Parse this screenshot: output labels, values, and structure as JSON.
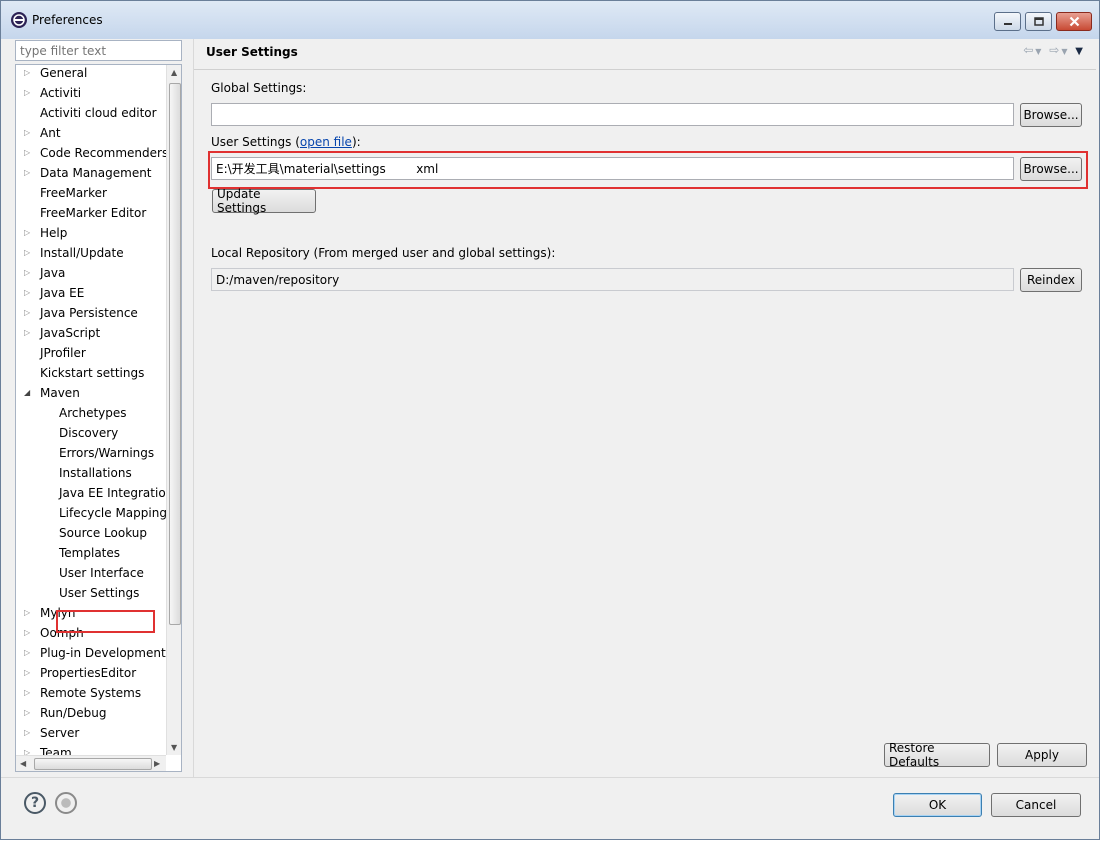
{
  "window": {
    "title": "Preferences"
  },
  "filter": {
    "placeholder": "type filter text"
  },
  "tree": {
    "items": [
      {
        "label": "General",
        "level": 0,
        "expandable": true
      },
      {
        "label": "Activiti",
        "level": 0,
        "expandable": true
      },
      {
        "label": "Activiti cloud editor",
        "level": 0,
        "expandable": false
      },
      {
        "label": "Ant",
        "level": 0,
        "expandable": true
      },
      {
        "label": "Code Recommenders",
        "level": 0,
        "expandable": true
      },
      {
        "label": "Data Management",
        "level": 0,
        "expandable": true
      },
      {
        "label": "FreeMarker",
        "level": 0,
        "expandable": false
      },
      {
        "label": "FreeMarker Editor",
        "level": 0,
        "expandable": false
      },
      {
        "label": "Help",
        "level": 0,
        "expandable": true
      },
      {
        "label": "Install/Update",
        "level": 0,
        "expandable": true
      },
      {
        "label": "Java",
        "level": 0,
        "expandable": true
      },
      {
        "label": "Java EE",
        "level": 0,
        "expandable": true
      },
      {
        "label": "Java Persistence",
        "level": 0,
        "expandable": true
      },
      {
        "label": "JavaScript",
        "level": 0,
        "expandable": true
      },
      {
        "label": "JProfiler",
        "level": 0,
        "expandable": false
      },
      {
        "label": "Kickstart settings",
        "level": 0,
        "expandable": false
      },
      {
        "label": "Maven",
        "level": 0,
        "expandable": true,
        "expanded": true
      },
      {
        "label": "Archetypes",
        "level": 1
      },
      {
        "label": "Discovery",
        "level": 1
      },
      {
        "label": "Errors/Warnings",
        "level": 1
      },
      {
        "label": "Installations",
        "level": 1
      },
      {
        "label": "Java EE Integration",
        "level": 1
      },
      {
        "label": "Lifecycle Mapping",
        "level": 1
      },
      {
        "label": "Source Lookup",
        "level": 1
      },
      {
        "label": "Templates",
        "level": 1
      },
      {
        "label": "User Interface",
        "level": 1
      },
      {
        "label": "User Settings",
        "level": 1,
        "selected": true
      },
      {
        "label": "Mylyn",
        "level": 0,
        "expandable": true
      },
      {
        "label": "Oomph",
        "level": 0,
        "expandable": true
      },
      {
        "label": "Plug-in Development",
        "level": 0,
        "expandable": true
      },
      {
        "label": "PropertiesEditor",
        "level": 0,
        "expandable": true
      },
      {
        "label": "Remote Systems",
        "level": 0,
        "expandable": true
      },
      {
        "label": "Run/Debug",
        "level": 0,
        "expandable": true
      },
      {
        "label": "Server",
        "level": 0,
        "expandable": true
      },
      {
        "label": "Team",
        "level": 0,
        "expandable": true
      }
    ]
  },
  "content": {
    "title": "User Settings",
    "global_label": "Global Settings:",
    "global_value": "",
    "browse_label": "Browse...",
    "user_label_prefix": "User Settings (",
    "open_file_link": "open file",
    "user_label_suffix": "):",
    "user_value": "E:\\开发工具\\material\\settings        xml",
    "update_settings": "Update Settings",
    "local_repo_label": "Local Repository (From merged user and global settings):",
    "local_repo_value": "D:/maven/repository",
    "reindex": "Reindex",
    "restore_defaults": "Restore Defaults",
    "apply": "Apply"
  },
  "footer": {
    "ok": "OK",
    "cancel": "Cancel"
  },
  "colors": {
    "highlight": "#e03131",
    "link": "#0645ad"
  },
  "icons": [
    "eclipse-icon",
    "minimize-icon",
    "maximize-icon",
    "close-icon",
    "back-arrow-icon",
    "forward-arrow-icon",
    "view-menu-icon",
    "help-icon",
    "preferences-link-icon"
  ]
}
